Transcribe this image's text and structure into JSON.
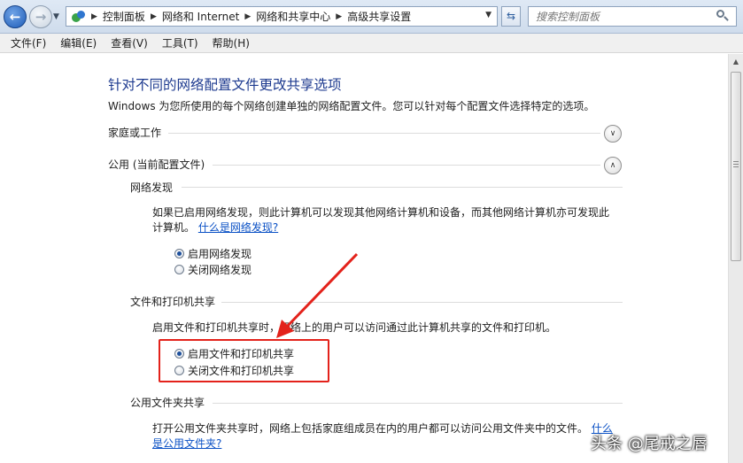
{
  "address_bar": {
    "breadcrumbs": [
      "控制面板",
      "网络和 Internet",
      "网络和共享中心",
      "高级共享设置"
    ],
    "search_placeholder": "搜索控制面板"
  },
  "menu": [
    "文件(F)",
    "编辑(E)",
    "查看(V)",
    "工具(T)",
    "帮助(H)"
  ],
  "page": {
    "title": "针对不同的网络配置文件更改共享选项",
    "description": "Windows 为您所使用的每个网络创建单独的网络配置文件。您可以针对每个配置文件选择特定的选项。",
    "profiles": [
      {
        "label": "家庭或工作",
        "expanded": false
      },
      {
        "label": "公用 (当前配置文件)",
        "expanded": true
      }
    ],
    "network_discovery": {
      "heading": "网络发现",
      "text_line1": "如果已启用网络发现，则此计算机可以发现其他网络计算机和设备，而其他网络计算机亦可发现此",
      "text_line2": "计算机。",
      "link": "什么是网络发现?",
      "options": [
        {
          "label": "启用网络发现",
          "checked": true
        },
        {
          "label": "关闭网络发现",
          "checked": false
        }
      ]
    },
    "file_printer_sharing": {
      "heading": "文件和打印机共享",
      "text": "启用文件和打印机共享时，网络上的用户可以访问通过此计算机共享的文件和打印机。",
      "options": [
        {
          "label": "启用文件和打印机共享",
          "checked": true
        },
        {
          "label": "关闭文件和打印机共享",
          "checked": false
        }
      ]
    },
    "public_folder_sharing": {
      "heading": "公用文件夹共享",
      "text": "打开公用文件夹共享时，网络上包括家庭组成员在内的用户都可以访问公用文件夹中的文件。",
      "link_part1": "什么",
      "link_part2": "是公用文件夹?"
    }
  },
  "watermark": "头条 @尾戒之唇",
  "colors": {
    "title": "#1d3a8f",
    "link": "#0b51c5",
    "annotation": "#e3221b"
  }
}
